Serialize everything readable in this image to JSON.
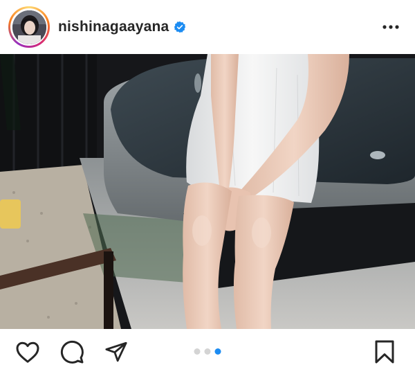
{
  "post": {
    "username": "nishinagaayana",
    "verified": true,
    "carousel": {
      "total": 3,
      "active_index": 2
    }
  },
  "icons": {
    "more": "more-horizontal-icon",
    "like": "heart-icon",
    "comment": "comment-icon",
    "share": "paper-plane-icon",
    "save": "bookmark-icon",
    "verified": "verified-badge-icon"
  },
  "colors": {
    "verified_blue": "#1c8cf2",
    "active_dot": "#1c8cf2",
    "inactive_dot": "#d4d4d4",
    "text": "#262626"
  }
}
